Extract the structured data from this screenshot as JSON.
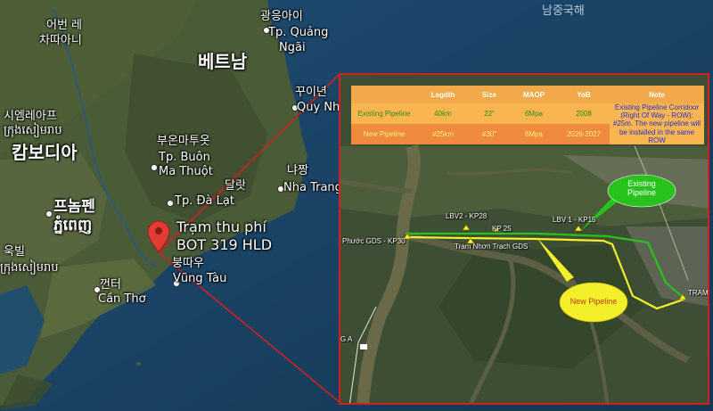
{
  "map_labels": {
    "east_sea": "남중국해",
    "quang_ngai_1": "광응아이",
    "quang_ngai_2": "Tp. Quảng",
    "quang_ngai_3": "Ngãi",
    "vietnam": "베트남",
    "quy_nhon_ko": "꾸이년",
    "quy_nhon": "Quy Nhơn",
    "buon_ma_thuot_ko": "부온마투옷",
    "buon_ma_thuot_1": "Tp. Buôn",
    "buon_ma_thuot_2": "Ma Thuột",
    "nha_trang_ko": "냐짱",
    "nha_trang": "Nha Trang",
    "da_lat_ko": "달랏",
    "da_lat": "Tp. Đà Lạt",
    "udon_ko_1": "어번 레",
    "udon_ko_2": "차따아니",
    "siem_reap_ko": "시엠레아프",
    "siem_reap_km": "ក្រុងសៀមរាប",
    "cambodia": "캄보디아",
    "phnom_penh_ko": "프놈펜",
    "phnom_penh_km": "ភ្នំពេញ",
    "kampot_ko": "욱빌",
    "kampot_km": "ក្រុងសៀមរាប",
    "vung_tau_ko": "붕따우",
    "vung_tau": "Vũng Tàu",
    "can_tho_ko": "껀터",
    "can_tho": "Cần Thơ",
    "pin_label_1": "Trạm thu phí",
    "pin_label_2": "BOT 319 HLD"
  },
  "pipeline_table": {
    "headers": [
      "",
      "Legdth",
      "Size",
      "MAOP",
      "YoB",
      "Note"
    ],
    "rows": [
      {
        "name": "Existing Pipeline",
        "length": "40km",
        "size": "22\"",
        "maop": "6Mpa",
        "yob": "2008",
        "note": "Existing Pipeline Corridoor (Right Of Way - ROW): #25m. The new pipeline will be installed in the same ROW"
      },
      {
        "name": "New Pipeline",
        "length": "#25km",
        "size": "#30\"",
        "maop": "8Mpa",
        "yob": "2026-2027",
        "note": ""
      }
    ]
  },
  "inset_labels": {
    "lbv2": "LBV2 - KP28",
    "lbv1": "LBV 1 - KP15",
    "kp25": "KP 25",
    "phuoc": "Phước GDS - KP30",
    "nhon_trach": "Tram Nhơn Trạch GDS",
    "tram": "TRAM",
    "ga": "G A"
  },
  "callouts": {
    "existing": "Existing Pipeline",
    "new": "New Pipeline"
  },
  "colors": {
    "existing_pipeline": "#27c21b",
    "new_pipeline": "#f4ef2b",
    "pin": "#e23b33",
    "frame": "#d21f1f"
  }
}
